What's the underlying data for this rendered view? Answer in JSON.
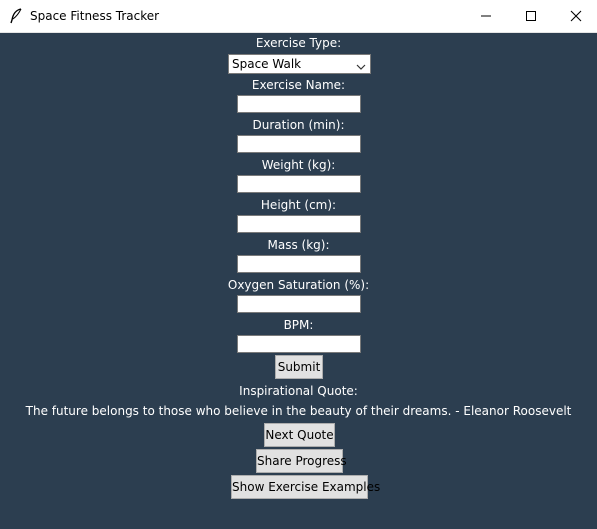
{
  "window": {
    "title": "Space Fitness Tracker",
    "icon": "feather-icon",
    "controls": [
      "minimize-icon",
      "maximize-icon",
      "close-icon"
    ]
  },
  "form": {
    "exercise_type_label": "Exercise Type:",
    "exercise_type_value": "Space Walk",
    "exercise_name_label": "Exercise Name:",
    "duration_label": "Duration (min):",
    "weight_label": "Weight (kg):",
    "height_label": "Height (cm):",
    "mass_label": "Mass (kg):",
    "oxygen_label": "Oxygen Saturation (%):",
    "bpm_label": "BPM:",
    "submit_label": "Submit"
  },
  "quote": {
    "heading": "Inspirational Quote:",
    "text": "The future belongs to those who believe in the beauty of their dreams. - Eleanor Roosevelt",
    "next_label": "Next Quote"
  },
  "actions": {
    "share_label": "Share Progress",
    "examples_label": "Show Exercise Examples"
  },
  "colors": {
    "background": "#2c3e50",
    "text": "#ffffff",
    "button_face": "#e1e1e1"
  }
}
